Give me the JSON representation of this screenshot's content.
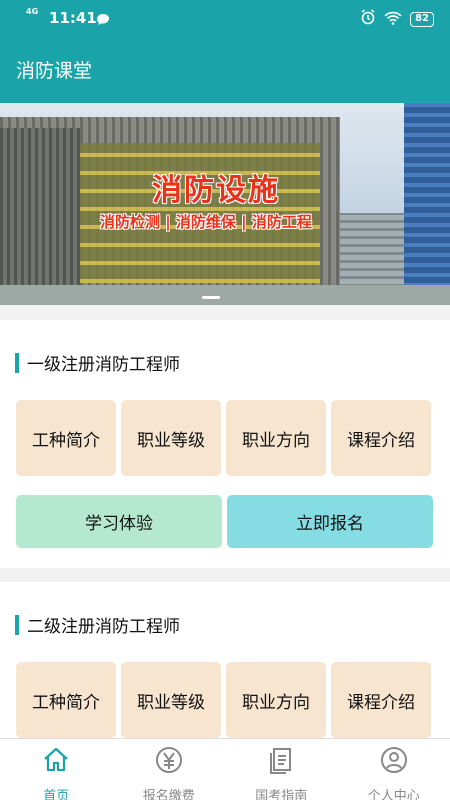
{
  "status_bar": {
    "network": "4G",
    "time": "11:41",
    "battery": "82"
  },
  "app_bar": {
    "title": "消防课堂"
  },
  "banner": {
    "title": "消防设施",
    "subtitle": "消防检测 | 消防维保 | 消防工程"
  },
  "sections": [
    {
      "title": "一级注册消防工程师",
      "tiles": [
        "工种简介",
        "职业等级",
        "职业方向",
        "课程介绍"
      ],
      "actions": [
        "学习体验",
        "立即报名"
      ]
    },
    {
      "title": "二级注册消防工程师",
      "tiles": [
        "工种简介",
        "职业等级",
        "职业方向",
        "课程介绍"
      ]
    }
  ],
  "tabbar": {
    "items": [
      {
        "label": "首页",
        "icon": "home-icon",
        "active": true
      },
      {
        "label": "报名缴费",
        "icon": "yen-icon",
        "active": false
      },
      {
        "label": "国考指南",
        "icon": "document-icon",
        "active": false
      },
      {
        "label": "个人中心",
        "icon": "user-icon",
        "active": false
      }
    ]
  },
  "colors": {
    "primary": "#1aa3a8",
    "tile": "#f7e5d0",
    "green": "#b5e8d1",
    "cyan": "#85dde3"
  }
}
